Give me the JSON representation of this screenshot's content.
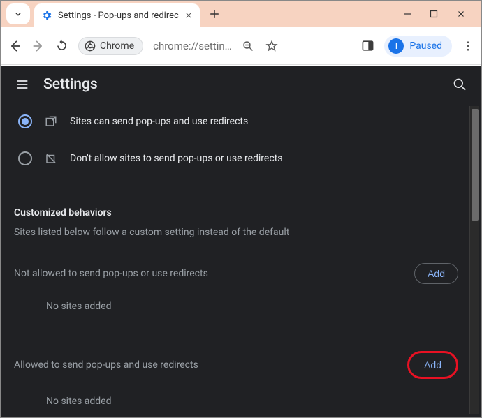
{
  "browser": {
    "tab_title": "Settings - Pop-ups and redirec",
    "url_display": "chrome://settin…",
    "chrome_chip_label": "Chrome",
    "profile_label": "Paused",
    "avatar_initial": "I"
  },
  "header": {
    "title": "Settings"
  },
  "default_behavior": {
    "options": [
      {
        "label": "Sites can send pop-ups and use redirects",
        "selected": true
      },
      {
        "label": "Don't allow sites to send pop-ups or use redirects",
        "selected": false
      }
    ]
  },
  "custom": {
    "heading": "Customized behaviors",
    "subtext": "Sites listed below follow a custom setting instead of the default",
    "not_allowed": {
      "title": "Not allowed to send pop-ups or use redirects",
      "add_label": "Add",
      "empty": "No sites added"
    },
    "allowed": {
      "title": "Allowed to send pop-ups and use redirects",
      "add_label": "Add",
      "empty": "No sites added"
    }
  }
}
